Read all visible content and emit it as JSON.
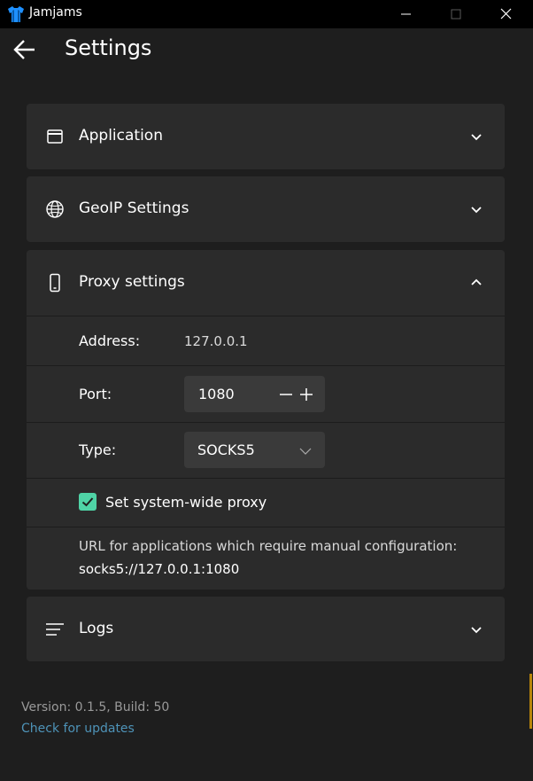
{
  "window": {
    "app_name": "Jamjams",
    "controls": [
      "minimize",
      "maximize",
      "close"
    ]
  },
  "header": {
    "title": "Settings",
    "back_icon": "arrow-left-icon"
  },
  "sections": {
    "application": {
      "title": "Application",
      "icon": "window-icon",
      "expanded": false
    },
    "geoip": {
      "title": "GeoIP Settings",
      "icon": "globe-icon",
      "expanded": false
    },
    "proxy": {
      "title": "Proxy settings",
      "icon": "mobile-device-icon",
      "expanded": true,
      "address_label": "Address:",
      "address_value": "127.0.0.1",
      "port_label": "Port:",
      "port_value": "1080",
      "type_label": "Type:",
      "type_value": "SOCKS5",
      "system_proxy_label": "Set system-wide proxy",
      "system_proxy_checked": true,
      "url_note": "URL for applications which require manual configuration:",
      "url_value": "socks5://127.0.0.1:1080"
    },
    "logs": {
      "title": "Logs",
      "icon": "lines-icon",
      "expanded": false
    }
  },
  "footer": {
    "version": "Version: 0.1.5, Build: 50",
    "check_updates": "Check for updates"
  },
  "colors": {
    "background": "#1e1e1e",
    "card": "#2b2b2b",
    "titlebar": "#000000",
    "accent_checkbox": "#4fd3a6",
    "link": "#4e93b8",
    "app_icon": "#1e90ff"
  }
}
